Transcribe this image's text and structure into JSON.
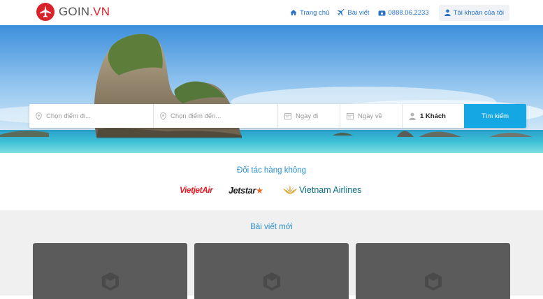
{
  "brand": {
    "name_prefix": "GOIN",
    "name_suffix": ".VN",
    "color": "#d9232a"
  },
  "nav": {
    "home": "Trang chủ",
    "posts": "Bài viết",
    "phone": "0888.06.2233",
    "account": "Tài khoản của tôi",
    "icons": [
      "home-icon",
      "plane-icon",
      "phone-icon",
      "user-icon"
    ]
  },
  "search": {
    "from_placeholder": "Chọn điểm đi...",
    "to_placeholder": "Chọn điểm đến...",
    "depart_placeholder": "Ngày đi",
    "return_placeholder": "Ngày về",
    "guests": "1 Khách",
    "submit": "Tìm kiếm",
    "accent": "#15a6e4"
  },
  "partners": {
    "title": "Đối tác hàng không",
    "airlines": [
      "VietjetAir",
      "Jetstar",
      "Vietnam Airlines"
    ]
  },
  "articles": {
    "title": "Bài viết mới",
    "cards": [
      "",
      "",
      ""
    ]
  }
}
